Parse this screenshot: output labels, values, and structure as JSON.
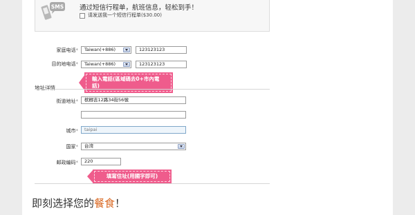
{
  "sms": {
    "icon_text": "SMS",
    "title": "通过短信行程单，航班信息，轻松到手！",
    "checkbox_label": "请发送我一个短信行程单($30.00)"
  },
  "phone": {
    "home_label": "家庭电话",
    "home_country": "Taiwan(+886)",
    "home_number": "123123123",
    "dest_label": "目的地电话",
    "dest_country": "Taiwan(+886)",
    "dest_number": "123123123"
  },
  "annotations": {
    "phone_hint": "輸入電話(區域碼去0+市內電話)",
    "address_hint": "填寫住址(用國字即可)"
  },
  "address": {
    "section_title": "地址详情",
    "street_label": "街道地址",
    "street_line1": "槟榔吉12路34街56號",
    "street_line2": "",
    "city_label": "城市",
    "city_value": "taipai",
    "country_label": "国家",
    "country_value": "台湾",
    "postal_label": "邮政编码",
    "postal_value": "220"
  },
  "headline": {
    "prefix": "即刻选择您的",
    "accent": "餐食",
    "suffix": "！"
  },
  "colors": {
    "banner": "#ef5c8c",
    "headline_accent": "#d9661f"
  }
}
